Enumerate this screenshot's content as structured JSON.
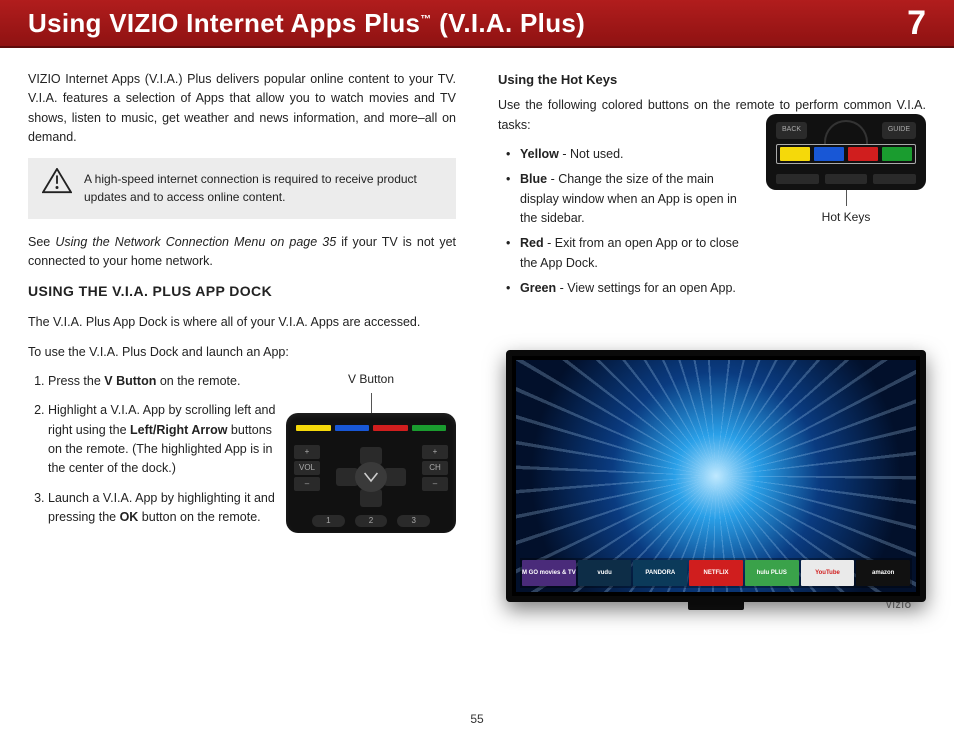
{
  "header": {
    "title_pre": "Using VIZIO Internet Apps Plus",
    "title_suf": " (V.I.A. Plus)",
    "tm": "™",
    "chapter": "7"
  },
  "left": {
    "intro": "VIZIO Internet Apps (V.I.A.) Plus delivers popular online content to your TV. V.I.A. features a selection of Apps that allow you to watch movies and TV shows, listen to music, get weather and news information, and more–all on demand.",
    "note": "A high-speed internet connection is required to receive product updates and to access online content.",
    "see_pre": "See ",
    "see_it": "Using the Network Connection Menu on page 35",
    "see_post": " if your TV is not yet connected to your home network.",
    "h2": "USING THE V.I.A. PLUS APP DOCK",
    "p1": "The V.I.A. Plus App Dock is where all of your V.I.A. Apps are accessed.",
    "p2": "To use the V.I.A. Plus Dock and launch an App:",
    "steps": [
      {
        "pre": "Press the ",
        "b": "V Button",
        "post": " on the remote."
      },
      {
        "pre": "Highlight a V.I.A. App by scrolling left and right using the ",
        "b": "Left/Right Arrow",
        "post": " buttons on the remote. (The highlighted App is in the center of the dock.)"
      },
      {
        "pre": "Launch a V.I.A. App by highlighting it and pressing the ",
        "b": "OK",
        "post": " button on the remote."
      }
    ],
    "remote_label": "V Button",
    "remote": {
      "vol": "VOL",
      "ch": "CH",
      "n1": "1",
      "n2": "2",
      "n3": "3",
      "plus": "+",
      "minus": "–"
    }
  },
  "right": {
    "h3": "Using the Hot Keys",
    "intro": "Use the following colored buttons on the remote to perform common V.I.A. tasks:",
    "items": [
      {
        "b": "Yellow",
        "t": " - Not used."
      },
      {
        "b": "Blue",
        "t": " - Change the size of the main display window when an App is open in the sidebar."
      },
      {
        "b": "Red",
        "t": " - Exit from an open App or to close the App Dock."
      },
      {
        "b": "Green",
        "t": " - View settings for an open App."
      }
    ],
    "hot_label": "Hot Keys",
    "hot_btns": {
      "back": "BACK",
      "guide": "GUIDE"
    },
    "tv": {
      "logo": "VIZIO",
      "apps": [
        {
          "label": "M GO movies & TV",
          "bg": "#4a2b7a"
        },
        {
          "label": "vudu",
          "bg": "#0d2d47"
        },
        {
          "label": "PANDORA",
          "bg": "#0b3a5a"
        },
        {
          "label": "NETFLIX",
          "bg": "#d01e1e"
        },
        {
          "label": "hulu PLUS",
          "bg": "#3aa24a"
        },
        {
          "label": "YouTube",
          "bg": "#eaeaea"
        },
        {
          "label": "amazon",
          "bg": "#111"
        }
      ]
    }
  },
  "pagenum": "55"
}
